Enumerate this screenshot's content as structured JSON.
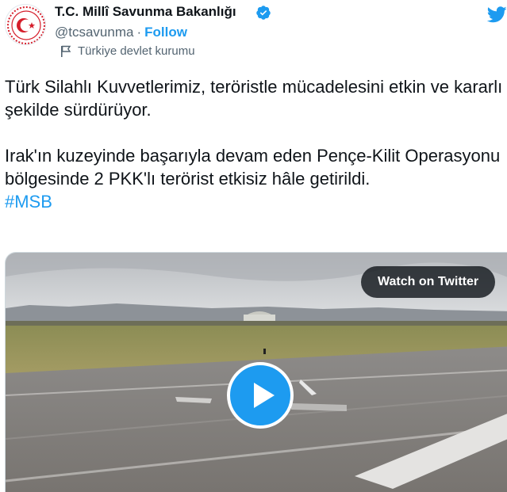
{
  "author": {
    "name": "T.C. Millî Savunma Bakanlığı",
    "handle": "@tcsavunma",
    "separator": "·",
    "follow_label": "Follow",
    "account_label": "Türkiye devlet kurumu"
  },
  "tweet": {
    "paragraph1": "Türk Silahlı Kuvvetlerimiz, teröristle mücadelesini etkin ve kararlı şekilde sürdürüyor.",
    "paragraph2": "Irak'ın kuzeyinde başarıyla devam eden Pençe-Kilit Operasyonu bölgesinde 2 PKK'lı terörist etkisiz hâle getirildi.",
    "hashtag": "#MSB"
  },
  "media": {
    "watch_label": "Watch on Twitter"
  },
  "icons": {
    "avatar": "crescent-star-logo",
    "verified": "verified-badge-icon",
    "label": "flag-icon",
    "brand": "twitter-bird-icon",
    "play": "play-icon"
  },
  "colors": {
    "accent": "#1d9bf0",
    "text": "#0f1419",
    "secondary": "#536471",
    "emblem_red": "#d51e2b"
  }
}
